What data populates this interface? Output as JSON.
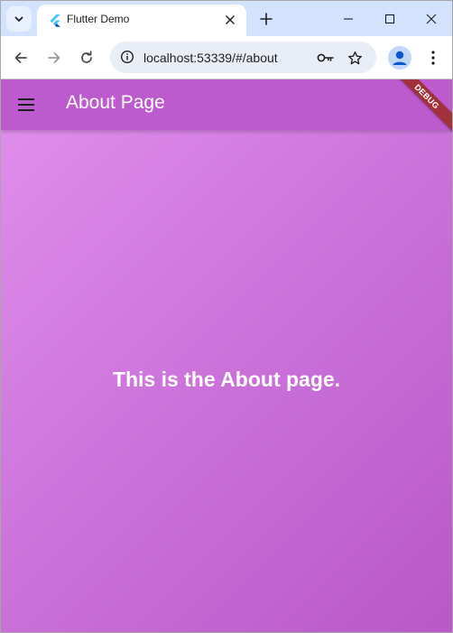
{
  "browser": {
    "tab": {
      "title": "Flutter Demo",
      "favicon": "flutter-icon"
    },
    "url": "localhost:53339/#/about",
    "icons": {
      "tab_search": "chevron-down-icon",
      "tab_close": "close-icon",
      "new_tab": "plus-icon",
      "minimize": "minimize-icon",
      "maximize": "maximize-icon",
      "close_window": "close-icon",
      "back": "arrow-left-icon",
      "forward": "arrow-right-icon",
      "reload": "reload-icon",
      "site_info": "info-icon",
      "passwords": "key-icon",
      "bookmark": "star-icon",
      "profile": "person-icon",
      "menu": "more-vertical-icon"
    },
    "colors": {
      "tabstrip": "#d3e3fd",
      "omnibox": "#e9eef6"
    }
  },
  "app": {
    "title": "About Page",
    "menu_icon": "hamburger-icon",
    "body_text": "This is the About page.",
    "debug_banner": "DEBUG",
    "colors": {
      "appbar": "#bd5bce",
      "gradient_start": "#df8deb",
      "gradient_end": "#b957c9",
      "debug_banner": "#a1313c"
    }
  }
}
